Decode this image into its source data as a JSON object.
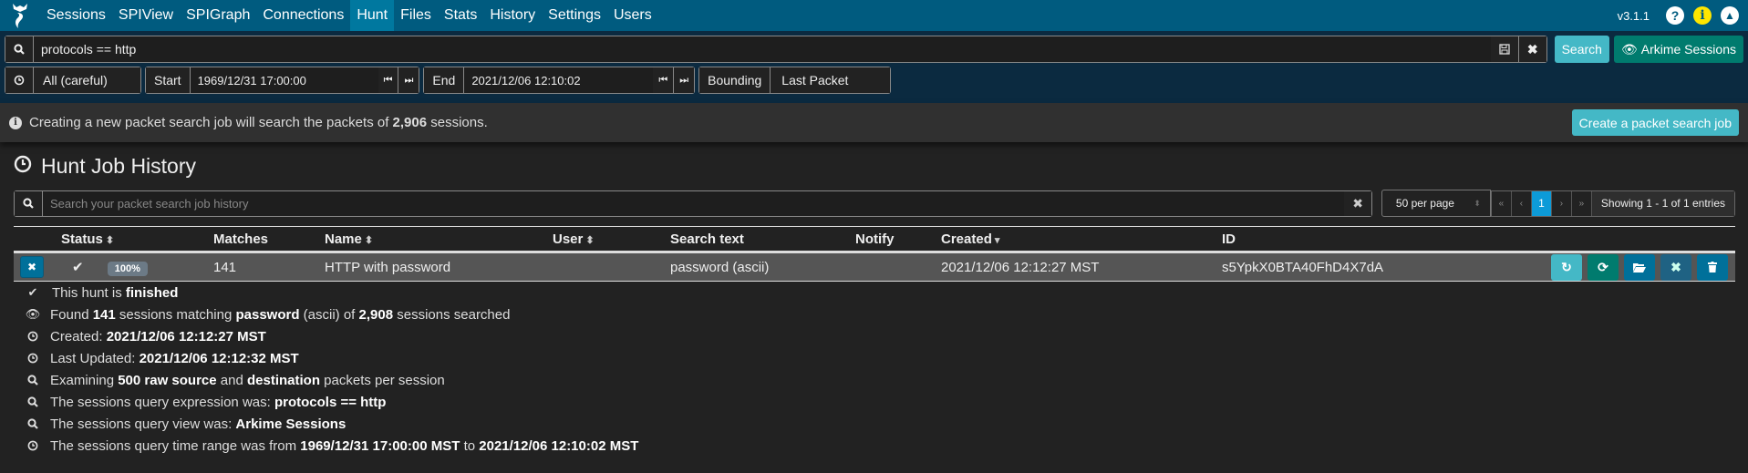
{
  "nav": {
    "items": [
      {
        "label": "Sessions",
        "active": false
      },
      {
        "label": "SPIView",
        "active": false
      },
      {
        "label": "SPIGraph",
        "active": false
      },
      {
        "label": "Connections",
        "active": false
      },
      {
        "label": "Hunt",
        "active": true
      },
      {
        "label": "Files",
        "active": false
      },
      {
        "label": "Stats",
        "active": false
      },
      {
        "label": "History",
        "active": false
      },
      {
        "label": "Settings",
        "active": false
      },
      {
        "label": "Users",
        "active": false
      }
    ],
    "version": "v3.1.1"
  },
  "search": {
    "expression": "protocols == http",
    "search_label": "Search",
    "view_label": "Arkime Sessions",
    "time_range": "All (careful)",
    "start_label": "Start",
    "start_value": "1969/12/31 17:00:00",
    "end_label": "End",
    "end_value": "2021/12/06 12:10:02",
    "bounding_label": "Bounding",
    "bounding_value": "Last Packet"
  },
  "info_bar": {
    "pre": "Creating a new packet search job will search the packets of ",
    "count": "2,906",
    "post": " sessions.",
    "create_label": "Create a packet search job"
  },
  "history": {
    "title": "Hunt Job History",
    "search_placeholder": "Search your packet search job history",
    "per_page": "50 per page",
    "pager": {
      "first": "«",
      "prev": "‹",
      "current": "1",
      "next": "›",
      "last": "»"
    },
    "showing": "Showing 1 - 1 of 1 entries",
    "columns": [
      "Status",
      "Matches",
      "Name",
      "User",
      "Search text",
      "Notify",
      "Created",
      "ID"
    ],
    "rows": [
      {
        "progress": "100%",
        "matches": "141",
        "name": "HTTP with password",
        "user": "",
        "search_text": "password (ascii)",
        "notify": "",
        "created": "2021/12/06 12:12:27 MST",
        "id": "s5YpkX0BTA40FhD4X7dA"
      }
    ]
  },
  "details": {
    "l1": {
      "a": "This hunt is ",
      "b": "finished"
    },
    "l2": {
      "a": "Found ",
      "b": "141",
      "c": " sessions matching ",
      "d": "password",
      "e": " (ascii) of ",
      "f": "2,908",
      "g": " sessions searched"
    },
    "l3": {
      "a": "Created: ",
      "b": "2021/12/06 12:12:27 MST"
    },
    "l4": {
      "a": "Last Updated: ",
      "b": "2021/12/06 12:12:32 MST"
    },
    "l5": {
      "a": "Examining ",
      "b": "500 raw source",
      "c": " and ",
      "d": "destination",
      "e": " packets per session"
    },
    "l6": {
      "a": "The sessions query expression was: ",
      "b": "protocols == http"
    },
    "l7": {
      "a": "The sessions query view was: ",
      "b": "Arkime Sessions"
    },
    "l8": {
      "a": "The sessions query time range was from ",
      "b": "1969/12/31 17:00:00 MST",
      "c": " to ",
      "d": "2021/12/06 12:10:02 MST"
    }
  },
  "colors": {
    "navbar": "#005b7f",
    "nav_active": "#00789f",
    "info_btn": "#44b8c6",
    "teal_btn": "#007b6e",
    "primary_btn": "#00709a",
    "page_active": "#0d9bd8"
  }
}
